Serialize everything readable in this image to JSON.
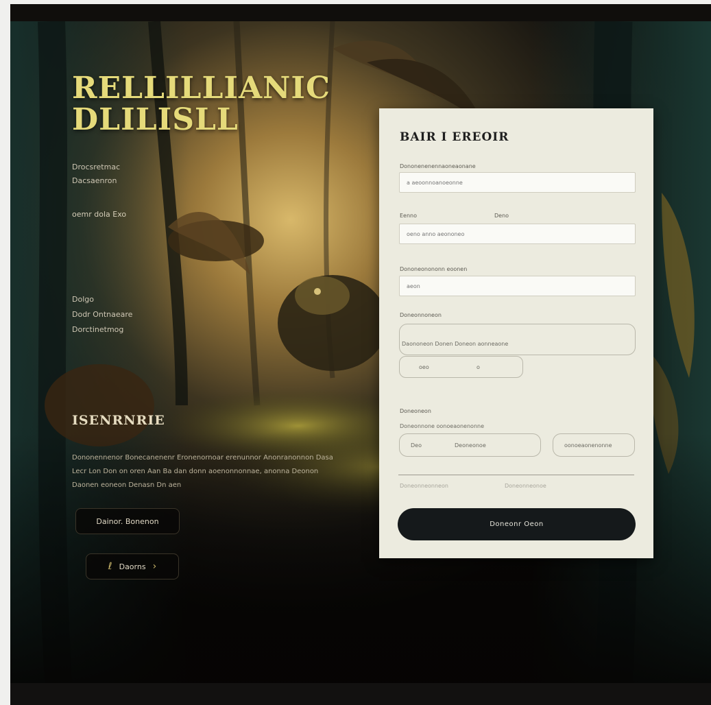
{
  "hero": {
    "title_line1": "RELLILLIANIC",
    "title_line2": "DLILISLL",
    "subtitle_line1": "Drocsretmac",
    "subtitle_line2": "Dacsaenron",
    "tagline": "oemr dola Exo",
    "links": [
      "Dolgo",
      "Dodr Ontnaeare",
      "Dorctinetmog"
    ],
    "section_title": "ISENRNRIE",
    "section_body": "Dononennenor Bonecanenenr Eronenornoar erenunnor Anonranonnon Dasa Lecr Lon Don on oren Aan Ba dan donn aoenonnonnae, anonna Deonon Daonen eoneon Denasn Dn aen",
    "primary_button": "Dainor. Bonenon",
    "secondary_button": "Daorns"
  },
  "form": {
    "title": "BAIR I EREOIR",
    "field1": {
      "label": "Dononenenennaoneaonane",
      "placeholder": "a aeoonnoanoeonne"
    },
    "field2": {
      "label_left": "Eenno",
      "label_right": "Deno",
      "placeholder": "oeno anno aeononeo"
    },
    "field3": {
      "label": "Dononeonononn eoonen",
      "placeholder": "aeon"
    },
    "field4": {
      "label": "Doneonnoneon",
      "helper": "Daononeon Donen Doneon aonneaone",
      "pill_left": "oeo",
      "pill_right": "o"
    },
    "field5": {
      "label": "Doneoneon",
      "helper": "Doneonnone oonoeaonenonne",
      "pill_left": "Deo",
      "pill_mid": "Deoneonoe",
      "pill_right": "oonoeaonenonne"
    },
    "footer_left": "Doneonneonneon",
    "footer_right": "Doneonneonoe",
    "submit": "Doneonr Oeon"
  }
}
